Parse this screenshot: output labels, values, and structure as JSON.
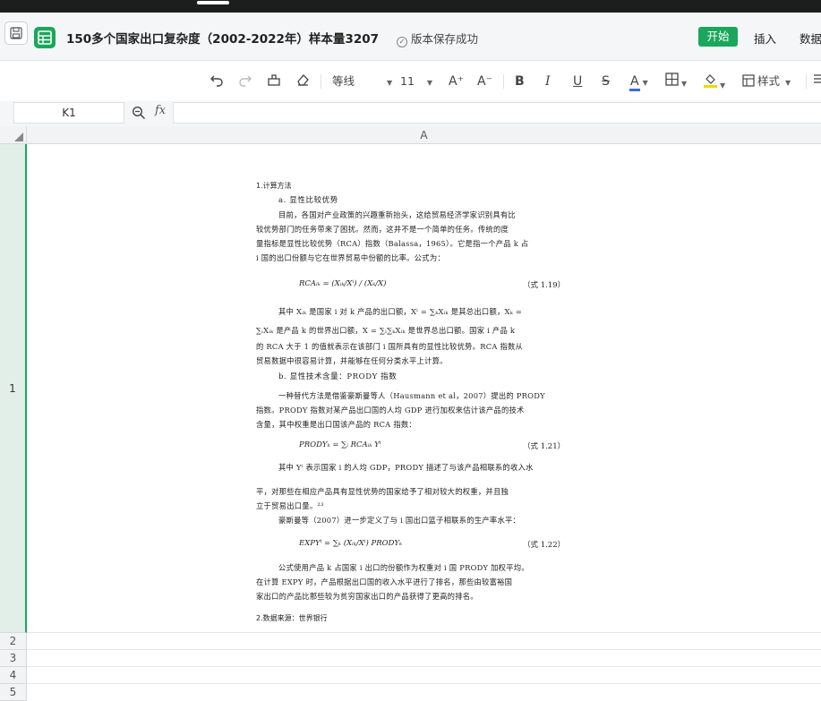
{
  "window": {
    "doc_title": "150多个国家出口复杂度（2002-2022年）样本量3207",
    "save_status": "版本保存成功",
    "menu": {
      "start": "开始",
      "insert": "插入",
      "data": "数据"
    }
  },
  "toolbar": {
    "font_family": "等线",
    "font_size": "11",
    "bold": "B",
    "italic": "I",
    "underline": "U",
    "strike": "S",
    "font_color_letter": "A",
    "grow_font": "A⁺",
    "shrink_font": "A⁻",
    "style_label": "样式",
    "colors": {
      "font_color": "#3a6bd8",
      "fill_color": "#f2d600",
      "accent": "#1aa75c"
    }
  },
  "formula_bar": {
    "cell_ref": "K1",
    "fx": "fx",
    "value": ""
  },
  "sheet": {
    "column_header": "A",
    "rows": [
      "1",
      "2",
      "3",
      "4",
      "5"
    ],
    "selected_row": "1"
  },
  "cell_image": {
    "heading": "1.计算方法",
    "section_a": "a.  显性比较优势",
    "para_a": [
      "目前，各国对产业政策的兴趣重新抬头，这给贸易经济学家识别具有比",
      "较优势部门的任务带来了困扰。然而，这并不是一个简单的任务。传统的度",
      "量指标是显性比较优势（RCA）指数（Balassa，1965）。它是指一个产品 k 占",
      "i 国的出口份额与它在世界贸易中份额的比率。公式为："
    ],
    "eq1": "RCAᵢₖ  =  (Xᵢₖ/Xⁱ) / (Xₖ/X)",
    "eq1_tag": "（式 1.19）",
    "para_a2": [
      "其中 Xᵢₖ 是国家 i 对 k 产品的出口额，Xⁱ = ∑ₖXᵢₖ 是其总出口额，Xₖ =",
      "∑ᵢXᵢₖ 是产品 k 的世界出口额，X = ∑ᵢ∑ₖXᵢₖ 是世界总出口额。国家 i 产品 k",
      "的 RCA 大于 1 的值就表示在该部门 i 国所具有的显性比较优势。RCA 指数从",
      "贸易数据中很容易计算，并能够在任何分类水平上计算。"
    ],
    "section_b": "b.  显性技术含量：PRODY 指数",
    "para_b": [
      "一种替代方法是借鉴豪斯曼等人（Hausmann et al，2007）提出的 PRODY",
      "指数。PRODY 指数对某产品出口国的人均 GDP 进行加权来估计该产品的技术",
      "含量，其中权重是出口国该产品的 RCA 指数："
    ],
    "eq2": "PRODYₖ  =  ∑ᵢ RCAᵢₖ Yⁱ",
    "eq2_tag": "（式 1.21）",
    "para_b2": [
      "其中 Yⁱ 表示国家 i 的人均 GDP，PRODY 描述了与该产品相联系的收入水",
      "平，对那些在相应产品具有显性优势的国家给予了相对较大的权重，并且独",
      "立于贸易出口量。²³",
      "豪斯曼等（2007）进一步定义了与 i 国出口篮子相联系的生产率水平："
    ],
    "eq3": "EXPYⁱ  =  ∑ₖ (Xᵢₖ/Xⁱ) PRODYₖ",
    "eq3_tag": "（式 1.22）",
    "para_c": [
      "公式使用产品 k 占国家 i 出口的份额作为权重对 i 国 PRODY 加权平均。",
      "在计算 EXPY 时，产品根据出口国的收入水平进行了排名，那些由较富裕国",
      "家出口的产品比那些较为贫穷国家出口的产品获得了更高的排名。"
    ],
    "source": "2.数据来源：世界银行"
  }
}
